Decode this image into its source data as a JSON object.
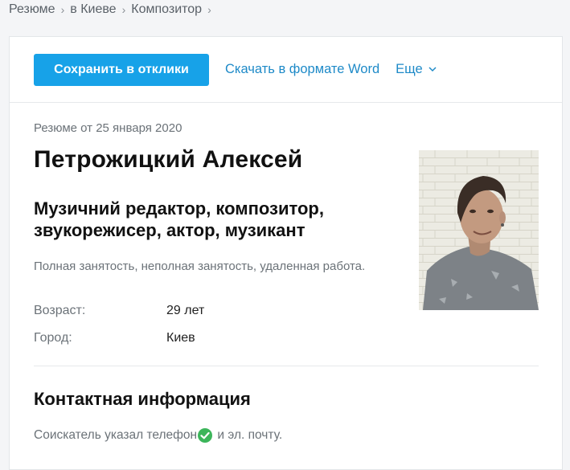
{
  "breadcrumb": [
    "Резюме",
    "в Киеве",
    "Композитор"
  ],
  "toolbar": {
    "save_label": "Сохранить в отклики",
    "word_label": "Скачать в формате Word",
    "more_label": "Еще"
  },
  "resume": {
    "date": "Резюме от 25 января 2020",
    "name": "Петрожицкий Алексей",
    "position": "Музичний редактор, композитор, звукорежисер, актор, музикант",
    "employment": "Полная занятость, неполная занятость, удаленная работа.",
    "age_label": "Возраст:",
    "age_value": "29 лет",
    "city_label": "Город:",
    "city_value": "Киев"
  },
  "contacts": {
    "title": "Контактная информация",
    "note_before": "Соискатель указал телефон",
    "note_after": " и эл. почту."
  },
  "colors": {
    "primary_button": "#17a2e8",
    "link": "#1e8ac8",
    "check": "#3cb55a"
  }
}
